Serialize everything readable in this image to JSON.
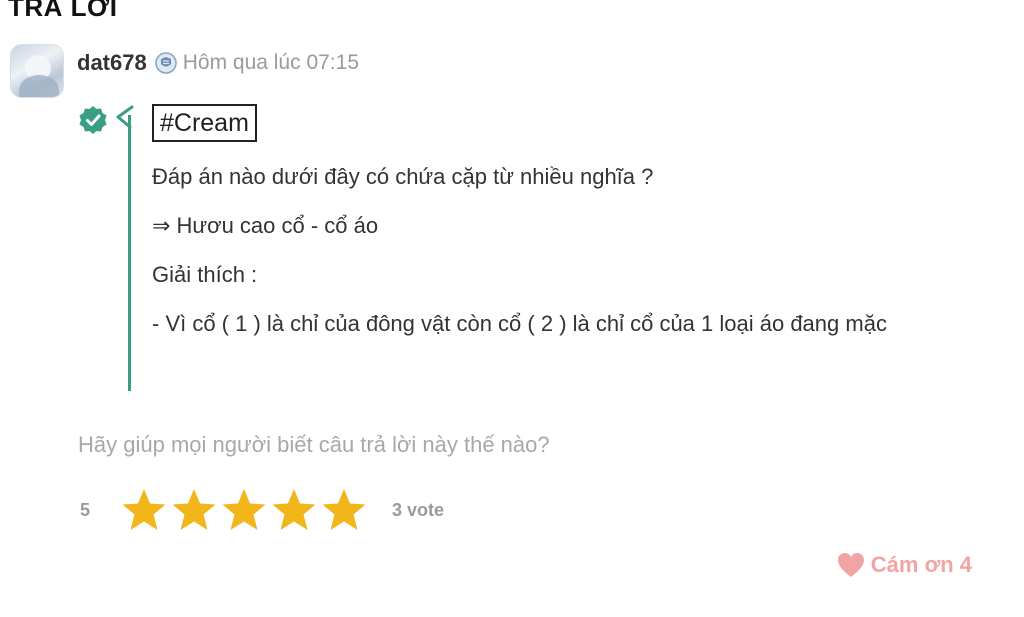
{
  "section_title": "TRẢ LỜI",
  "answer": {
    "author": "dat678",
    "rank_icon": "rank-badge-icon",
    "timestamp": "Hôm qua lúc 07:15",
    "verified_icon": "verified-check-icon",
    "tag": "#Cream",
    "lines": [
      "Đáp án nào dưới đây có chứa cặp từ nhiều nghĩa ?",
      "⇒ Hươu cao cổ - cổ áo",
      "Giải thích :",
      "- Vì cổ ( 1 ) là chỉ của đông vật còn cổ ( 2 ) là chỉ cổ của 1 loại áo đang mặc"
    ]
  },
  "feedback": {
    "prompt": "Hãy giúp mọi người biết câu trả lời này thế nào?",
    "rating_value": "5",
    "stars_filled": 5,
    "stars_total": 5,
    "vote_text": "3 vote",
    "thanks_label": "Cám ơn 4"
  },
  "colors": {
    "accent_green": "#3a9e84",
    "star_gold": "#f2b51a",
    "heart_pink": "#f2a3a3",
    "muted_text": "#9a9a9a"
  }
}
